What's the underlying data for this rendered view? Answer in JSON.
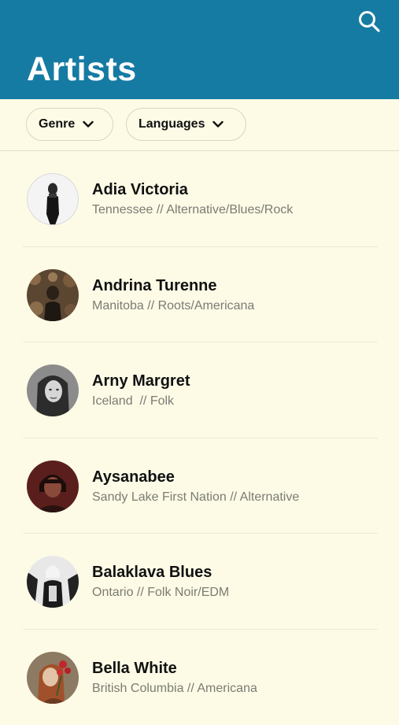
{
  "header": {
    "title": "Artists",
    "background": "#167ba3",
    "search_icon": "search-icon"
  },
  "filters": [
    {
      "label": "Genre",
      "icon": "chevron-down-icon"
    },
    {
      "label": "Languages",
      "icon": "chevron-down-icon"
    }
  ],
  "artists": [
    {
      "name": "Adia Victoria",
      "meta": "Tennessee // Alternative/Blues/Rock"
    },
    {
      "name": "Andrina Turenne",
      "meta": "Manitoba // Roots/Americana"
    },
    {
      "name": "Arny Margret",
      "meta": "Iceland  // Folk"
    },
    {
      "name": "Aysanabee",
      "meta": "Sandy Lake First Nation // Alternative"
    },
    {
      "name": "Balaklava Blues",
      "meta": "Ontario // Folk Noir/EDM"
    },
    {
      "name": "Bella White",
      "meta": "British Columbia // Americana"
    }
  ],
  "colors": {
    "page_background": "#fdfbe6",
    "header": "#167ba3",
    "secondary_text": "#7b7b74"
  }
}
